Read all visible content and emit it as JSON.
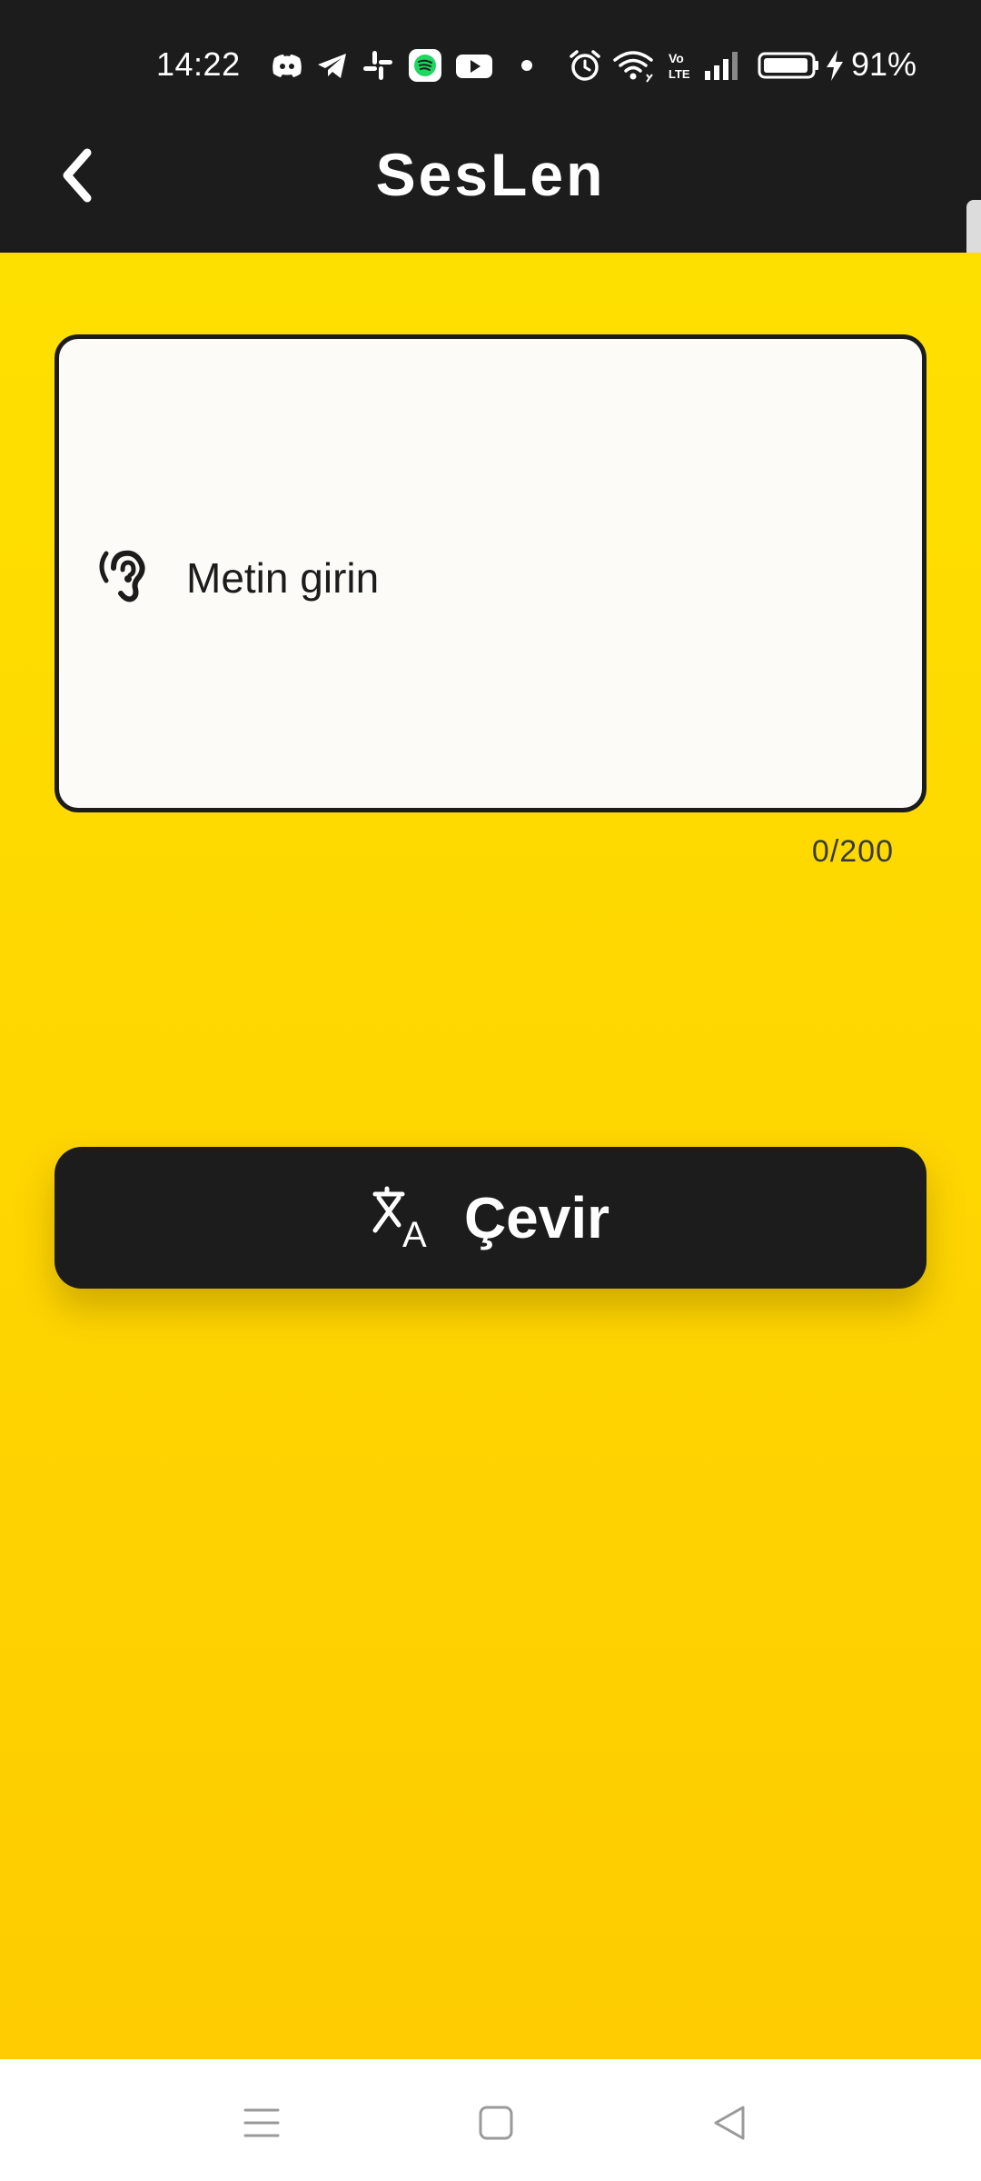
{
  "status_bar": {
    "time": "14:22",
    "battery_percent": "91%",
    "icons": [
      "discord-icon",
      "telegram-icon",
      "slack-icon",
      "spotify-icon",
      "youtube-icon",
      "dot-icon",
      "alarm-icon",
      "wifi-icon",
      "volte-icon",
      "signal-icon",
      "battery-icon",
      "charging-icon"
    ]
  },
  "app_bar": {
    "title": "SesLen",
    "back_icon": "chevron-left-icon"
  },
  "input": {
    "placeholder": "Metin girin",
    "value": "",
    "icon": "ear-icon",
    "counter": "0/200"
  },
  "translate_button": {
    "label": "Çevir",
    "icon": "translate-icon"
  },
  "nav_bar": {
    "buttons": [
      "menu-icon",
      "home-icon",
      "back-triangle-icon"
    ]
  },
  "colors": {
    "background": "#FEDC00",
    "dark": "#1C1C1C",
    "field": "#FCFBF8"
  }
}
